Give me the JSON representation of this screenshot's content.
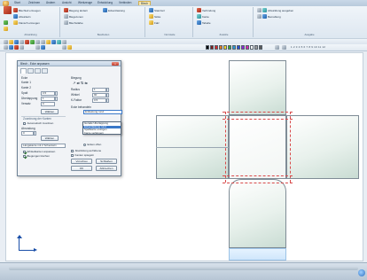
{
  "ribbon": {
    "tabs": [
      "Start",
      "Zeichnen",
      "Ändern",
      "Ansicht",
      "Werkzeuge",
      "Entwicklung",
      "Verbinden",
      "Blech"
    ],
    "active_tab_index": 7,
    "groups": [
      {
        "title": "Abwicklung",
        "buttons": [
          "Blechteil erzeugen",
          "Abwickeln",
          "Flansch erzeugen",
          "Lasche",
          "Rand"
        ]
      },
      {
        "title": "Bearbeiten",
        "buttons": [
          "Biegung ändern",
          "Biegezonen",
          "Blechstärke",
          "Eckentlastung"
        ]
      },
      {
        "title": "Normteile",
        "buttons": [
          "Stanzteil",
          "Sicke",
          "Falz"
        ]
      },
      {
        "title": "Zusätze",
        "buttons": [
          "Verbindung",
          "Kante",
          "Tabelle"
        ]
      },
      {
        "title": "Ausgabe",
        "buttons": [
          "Abwicklung ausgeben",
          "Bemaßung"
        ]
      }
    ]
  },
  "toolbar": {
    "number_strip": "1 2 3 4 5 6 7 8 9 10 11 12"
  },
  "dialog": {
    "title": "Blech - Ecke anpassen",
    "close_label": "x",
    "left": {
      "label_type": "Ecke",
      "label_edge1": "Kante 1",
      "label_edge2": "Kante 2",
      "label_value1": "Abstand",
      "label_gap": "Spalt",
      "label_overlap": "Überlappung",
      "label_offset": "Versatz",
      "value_gap": "0.5",
      "value_overlap": "1",
      "value_offset": "0",
      "button_select": "Wählen",
      "section_label": "Zuordnung der Kanten",
      "check_auto": "Automatisch zuordnen",
      "label_fillet": "Abrundung",
      "value_fillet": "0",
      "button_select2": "Wählen",
      "combo_label": "Längskante mit 2 Schenkeln",
      "check_angle": "Winkelkanten anpassen",
      "check_bend": "Biegungen löschen",
      "btn_preview": "Vorschau",
      "btn_close": "Schließen",
      "btn_ok": "OK",
      "btn_cancel": "Abbrechen"
    },
    "right": {
      "label_bend": "Biegung",
      "label_radius": "Radius",
      "value_radius": "1",
      "label_angle": "Winkel",
      "value_angle": "90",
      "label_k": "K-Faktor",
      "value_k": "0.5",
      "label_treat": "Ecke behandeln",
      "combo_value": "Entlastung rund",
      "option_1": "Gerade Überlappung",
      "option_2": "Spaltkante einfügen",
      "option_3": "Kante verlängern",
      "option_4": "Eckentlastung",
      "check_open": "Ecken offen",
      "check_flat": "Abwicklung auf Ebene",
      "check_mirror": "Kanten spiegeln"
    }
  },
  "dropdown": {
    "items": [
      "Gerade Überlappung",
      "Eckentlastung rund",
      "Spaltkante einfügen",
      "Kante verlängern"
    ],
    "selected_index": 1
  },
  "colors": {
    "accent": "#3a78c8",
    "bend_line": "#d84a4a",
    "panel_fill": "#e8f1ec",
    "axis": "#1a4fa8"
  }
}
